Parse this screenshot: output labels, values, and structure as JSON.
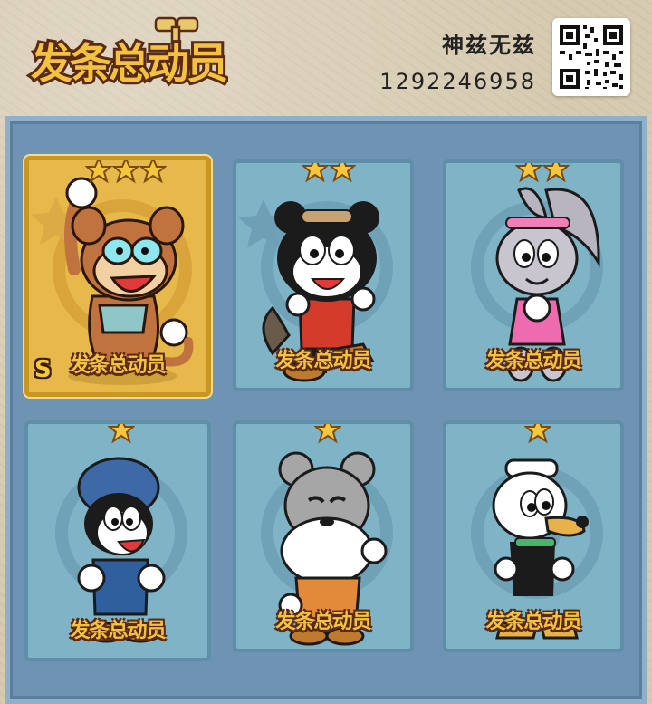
{
  "header": {
    "logo_text": "发条总动员",
    "author_name": "神兹无兹",
    "author_id": "1292246958"
  },
  "cards": [
    {
      "label": "发条总动员",
      "stars": 3,
      "rarity": "S",
      "highlighted": true,
      "character": "monkey",
      "main_color": "#c0723f"
    },
    {
      "label": "发条总动员",
      "stars": 2,
      "rarity": "",
      "highlighted": false,
      "character": "raccoon",
      "main_color": "#1b1b1b"
    },
    {
      "label": "发条总动员",
      "stars": 2,
      "rarity": "",
      "highlighted": false,
      "character": "rabbit",
      "main_color": "#b9b5c0"
    },
    {
      "label": "发条总动员",
      "stars": 1,
      "rarity": "",
      "highlighted": false,
      "character": "dog",
      "main_color": "#3d6aa6"
    },
    {
      "label": "发条总动员",
      "stars": 1,
      "rarity": "",
      "highlighted": false,
      "character": "mouse",
      "main_color": "#a6a6a6"
    },
    {
      "label": "发条总动员",
      "stars": 1,
      "rarity": "",
      "highlighted": false,
      "character": "duck",
      "main_color": "#ffffff"
    }
  ],
  "colors": {
    "panel": "#6f93b2",
    "card": "#7fb3c6",
    "gold_card": "#e6b94a",
    "label_gold": "#f3c241",
    "label_outline": "#5a2a12"
  }
}
